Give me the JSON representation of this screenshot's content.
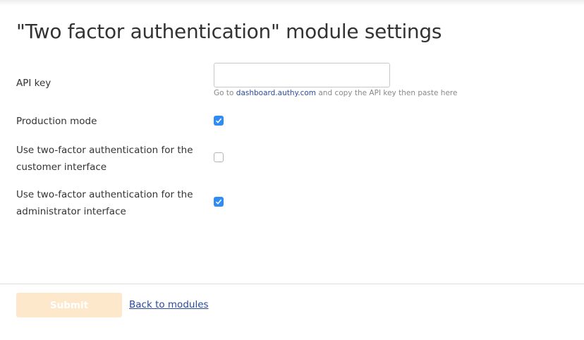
{
  "page": {
    "title": "\"Two factor authentication\" module settings"
  },
  "fields": {
    "api_key": {
      "label": "API key",
      "value": "",
      "help_prefix": "Go to ",
      "help_link": "dashboard.authy.com",
      "help_suffix": " and copy the API key then paste here"
    },
    "production_mode": {
      "label": "Production mode",
      "checked": true
    },
    "customer_2fa": {
      "label": "Use two-factor authentication for the customer interface",
      "checked": false
    },
    "admin_2fa": {
      "label": "Use two-factor authentication for the administrator interface",
      "checked": true
    }
  },
  "footer": {
    "submit_label": "Submit",
    "back_label": "Back to modules"
  },
  "colors": {
    "checkbox": "#2f8cf5",
    "submit_disabled": "#fde8cc",
    "link": "#2b4aa0"
  }
}
